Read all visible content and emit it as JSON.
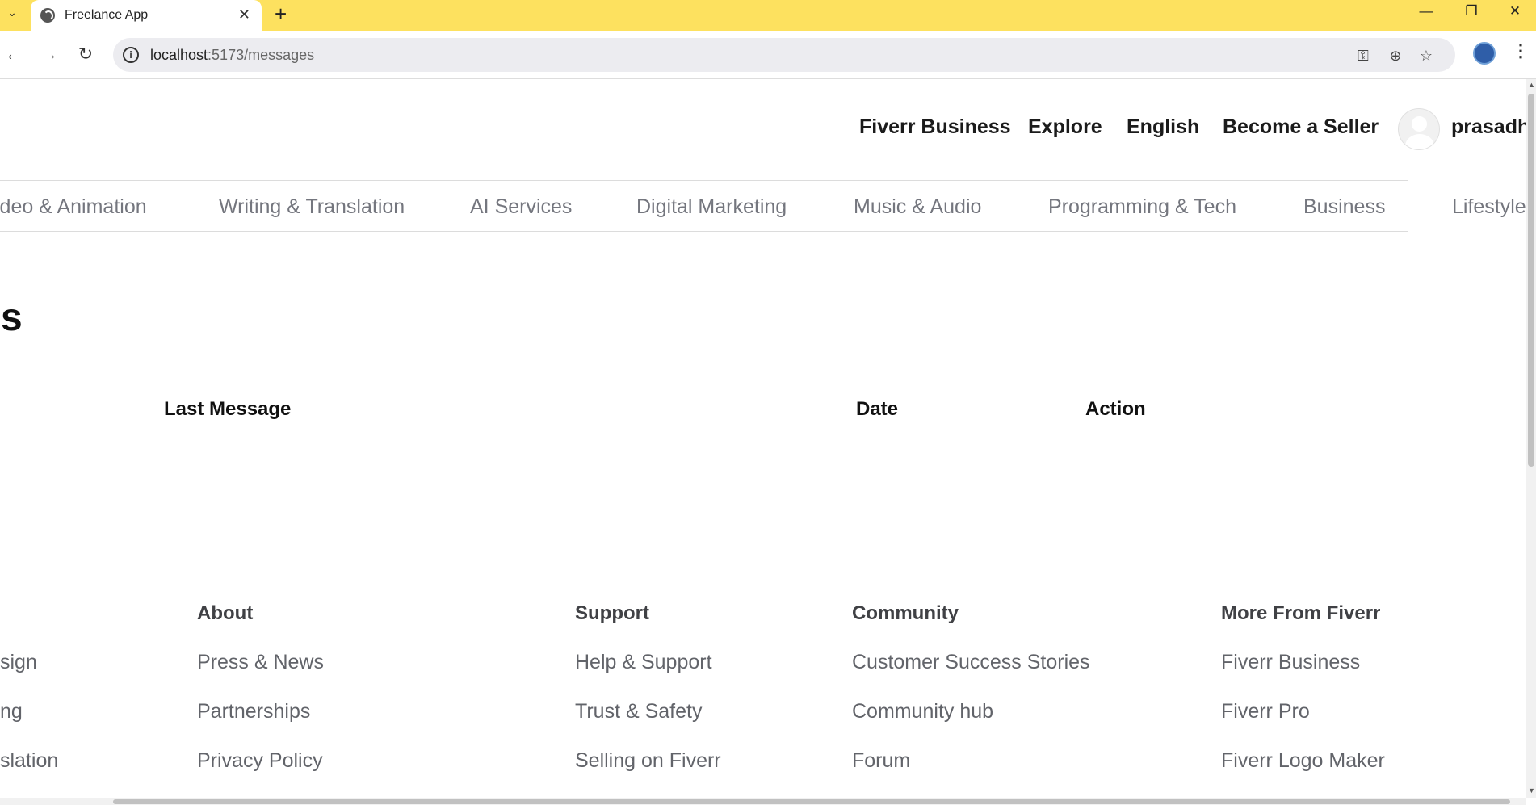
{
  "browser": {
    "tab_title": "Freelance App",
    "tab_close": "✕",
    "new_tab": "+",
    "url_host": "localhost",
    "url_path": ":5173/messages",
    "controls": {
      "minimize": "—",
      "restore": "❐",
      "close": "✕"
    }
  },
  "header": {
    "nav": [
      "Fiverr Business",
      "Explore",
      "English",
      "Become a Seller"
    ],
    "username": "prasadh"
  },
  "categories": [
    "ideo & Animation",
    "Writing & Translation",
    "AI Services",
    "Digital Marketing",
    "Music & Audio",
    "Programming & Tech",
    "Business",
    "Lifestyle"
  ],
  "main": {
    "title": "ges",
    "table_headers": [
      "Last Message",
      "Date",
      "Action"
    ]
  },
  "footer": {
    "partial_links": [
      "sign",
      "ng",
      "slation"
    ],
    "columns": [
      {
        "heading": "About",
        "links": [
          "Press & News",
          "Partnerships",
          "Privacy Policy"
        ]
      },
      {
        "heading": "Support",
        "links": [
          "Help & Support",
          "Trust & Safety",
          "Selling on Fiverr"
        ]
      },
      {
        "heading": "Community",
        "links": [
          "Customer Success Stories",
          "Community hub",
          "Forum"
        ]
      },
      {
        "heading": "More From Fiverr",
        "links": [
          "Fiverr Business",
          "Fiverr Pro",
          "Fiverr Logo Maker"
        ]
      }
    ]
  },
  "colors": {
    "tabbar": "#fde15f",
    "category_text": "#74767e",
    "footer_link": "#62646a"
  }
}
